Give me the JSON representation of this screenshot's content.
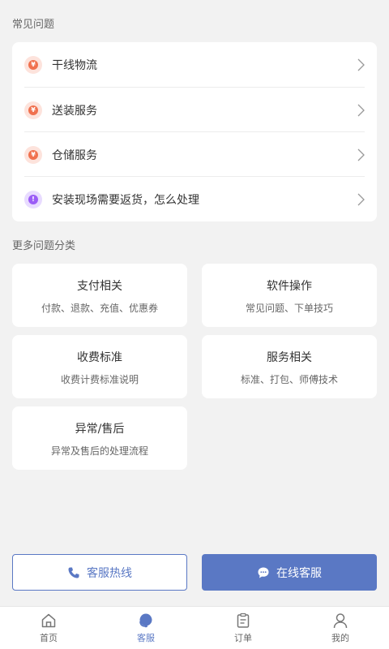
{
  "faq": {
    "title": "常见问题",
    "items": [
      {
        "label": "干线物流",
        "icon": "yuan-coin-icon"
      },
      {
        "label": "送装服务",
        "icon": "yuan-coin-icon"
      },
      {
        "label": "仓储服务",
        "icon": "yuan-coin-icon"
      },
      {
        "label": "安装现场需要返货，怎么处理",
        "icon": "alert-icon"
      }
    ]
  },
  "categories": {
    "title": "更多问题分类",
    "items": [
      {
        "title": "支付相关",
        "subtitle": "付款、退款、充值、优惠券"
      },
      {
        "title": "软件操作",
        "subtitle": "常见问题、下单技巧"
      },
      {
        "title": "收费标准",
        "subtitle": "收费计费标准说明"
      },
      {
        "title": "服务相关",
        "subtitle": "标准、打包、师傅技术"
      },
      {
        "title": "异常/售后",
        "subtitle": "异常及售后的处理流程"
      }
    ]
  },
  "actions": {
    "hotline_label": "客服热线",
    "online_label": "在线客服"
  },
  "tabbar": {
    "items": [
      {
        "label": "首页"
      },
      {
        "label": "客服"
      },
      {
        "label": "订单"
      },
      {
        "label": "我的"
      }
    ],
    "active_index": 1
  },
  "colors": {
    "accent": "#5a78c4",
    "coin_bg": "#fde3dc",
    "coin_fg": "#f0714f",
    "alert_bg": "#e8dbff",
    "alert_fg": "#9b5cf6"
  }
}
